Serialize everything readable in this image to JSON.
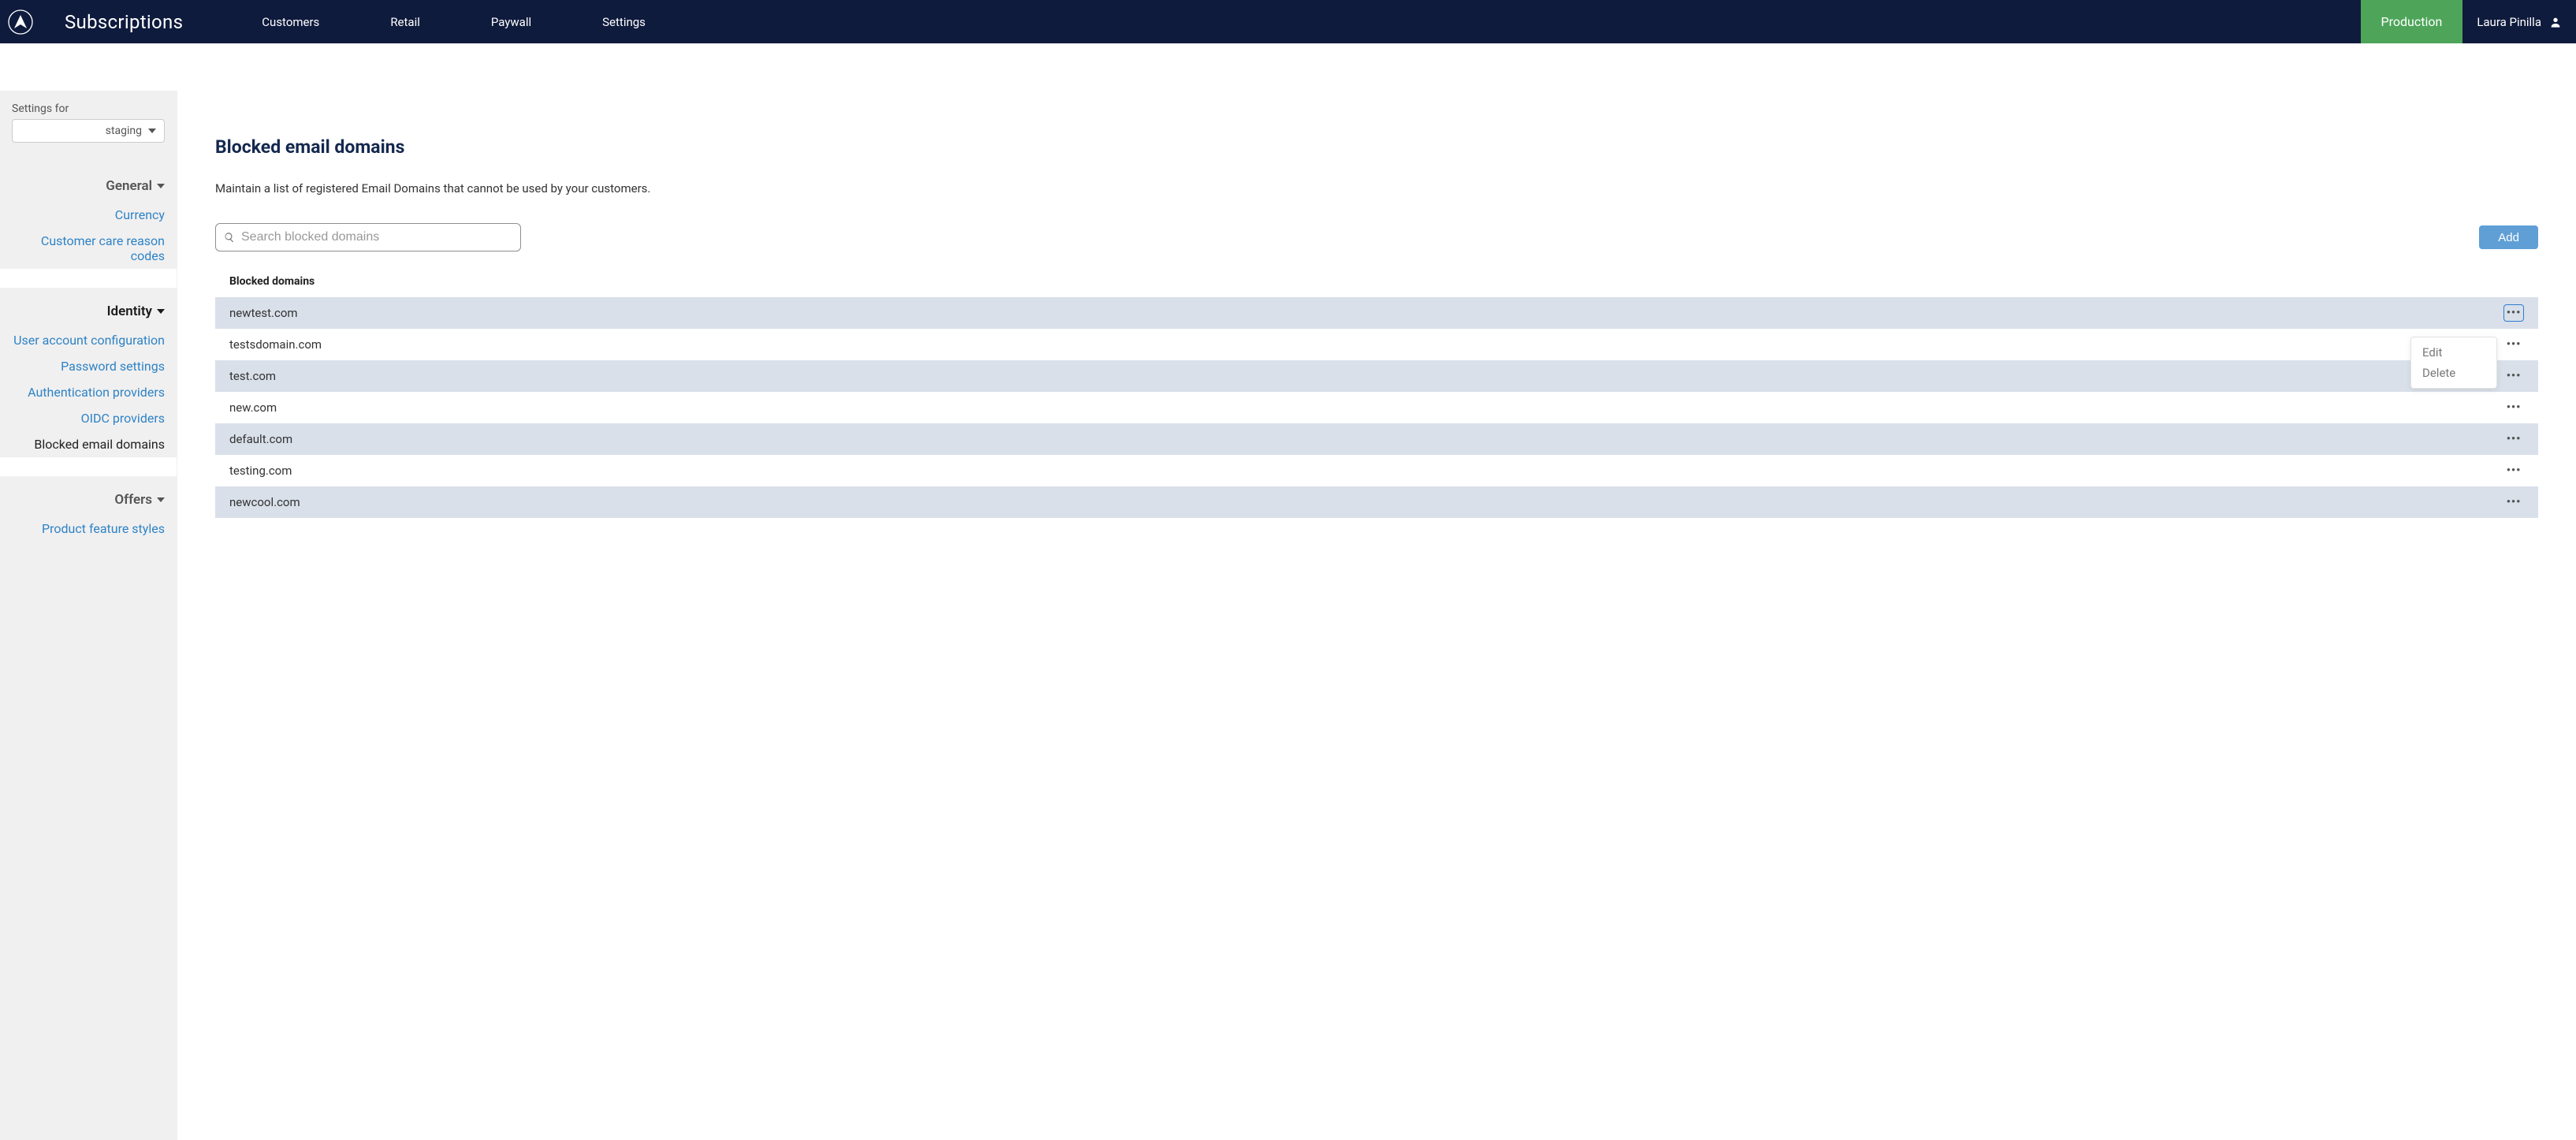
{
  "topnav": {
    "app_title": "Subscriptions",
    "links": [
      "Customers",
      "Retail",
      "Paywall",
      "Settings"
    ],
    "env_label": "Production",
    "user_name": "Laura Pinilla"
  },
  "sidebar": {
    "settings_for_label": "Settings for",
    "env_select_value": "staging",
    "sections": {
      "general": {
        "label": "General",
        "items": [
          "Currency",
          "Customer care reason codes"
        ]
      },
      "identity": {
        "label": "Identity",
        "items": [
          "User account configuration",
          "Password settings",
          "Authentication providers",
          "OIDC providers",
          "Blocked email domains"
        ],
        "active_index": 4
      },
      "offers": {
        "label": "Offers",
        "items": [
          "Product feature styles"
        ]
      }
    }
  },
  "main": {
    "title": "Blocked email domains",
    "subtitle": "Maintain a list of registered Email Domains that cannot be used by your customers.",
    "search_placeholder": "Search blocked domains",
    "add_label": "Add",
    "table": {
      "header": "Blocked domains",
      "rows": [
        "newtest.com",
        "testsdomain.com",
        "test.com",
        "new.com",
        "default.com",
        "testing.com",
        "newcool.com"
      ]
    },
    "row_menu": {
      "edit": "Edit",
      "delete": "Delete"
    }
  }
}
